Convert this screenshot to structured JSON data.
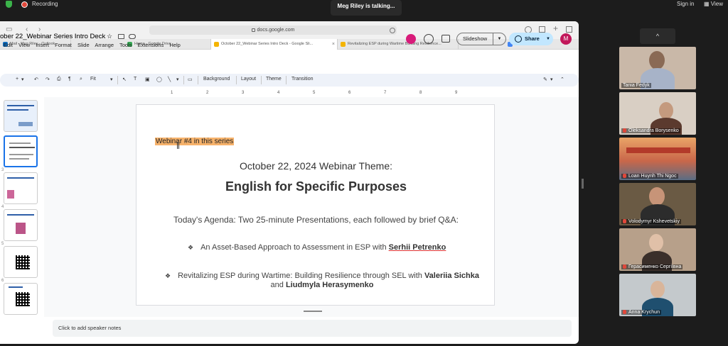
{
  "zoom": {
    "recording_label": "Recording",
    "talking_indicator": "Meg Riley is talking...",
    "sign_in": "Sign in",
    "view": "View",
    "collapse_symbol": "^"
  },
  "browser": {
    "url": "docs.google.com",
    "tabs": [
      {
        "label": "Mail - Meg Riley - Outlook",
        "color": "#0f6cbd"
      },
      {
        "label": "Home - Google Drive",
        "color": "#34a853"
      },
      {
        "label": "October 22_Webinar Series Intro Deck - Google Sli...",
        "color": "#f4b400",
        "active": true
      },
      {
        "label": "Revitalizing ESP during Wartime Building Resilience...",
        "color": "#f4b400"
      },
      {
        "label": "Voting",
        "color": "#4285f4"
      }
    ]
  },
  "slides_app": {
    "doc_title": "ober 22_Webinar Series Intro Deck",
    "menu": [
      "Edit",
      "View",
      "Insert",
      "Format",
      "Slide",
      "Arrange",
      "Tools",
      "Extensions",
      "Help"
    ],
    "slideshow_label": "Slideshow",
    "share_label": "Share",
    "avatar_initial": "M",
    "toolbar": {
      "zoom": "Fit",
      "background": "Background",
      "layout": "Layout",
      "theme": "Theme",
      "transition": "Transition"
    },
    "ruler_marks": [
      "1",
      "2",
      "3",
      "4",
      "5",
      "6",
      "7",
      "8",
      "9"
    ],
    "thumb_numbers": [
      "3",
      "4",
      "5",
      "6"
    ],
    "speaker_notes_placeholder": "Click to add speaker notes"
  },
  "slide": {
    "highlight": "Webinar #4 in this series",
    "theme_line": "October 22, 2024 Webinar Theme:",
    "title": "English for Specific Purposes",
    "agenda": "Today's Agenda: Two 25-minute Presentations, each followed by brief Q&A:",
    "bullet_symbol": "❖",
    "item1_text": "An Asset-Based Approach to Assessment in ESP with ",
    "item1_name": "Serhii Petrenko",
    "item2_text": "Revitalizing ESP during Wartime: Building Resilience through SEL with ",
    "item2_name1": "Valeriia Sichka",
    "item2_and": " and ",
    "item2_name2": "Liudmyla Herasymenko"
  },
  "participants": [
    {
      "name": "Tania Fedyk",
      "bg": "#c9b8a8"
    },
    {
      "name": "Oleksandra Borysenko",
      "bg": "#d9cfc4"
    },
    {
      "name": "Loan Huynh Thi Ngoc",
      "bg": "#d7804a"
    },
    {
      "name": "Volodymyr Kshevetskiy",
      "bg": "#6a5a44"
    },
    {
      "name": "Герасименко Сергіївна",
      "bg": "#b7a08a"
    },
    {
      "name": "Anna Krychun",
      "bg": "#c4c9cc"
    }
  ]
}
